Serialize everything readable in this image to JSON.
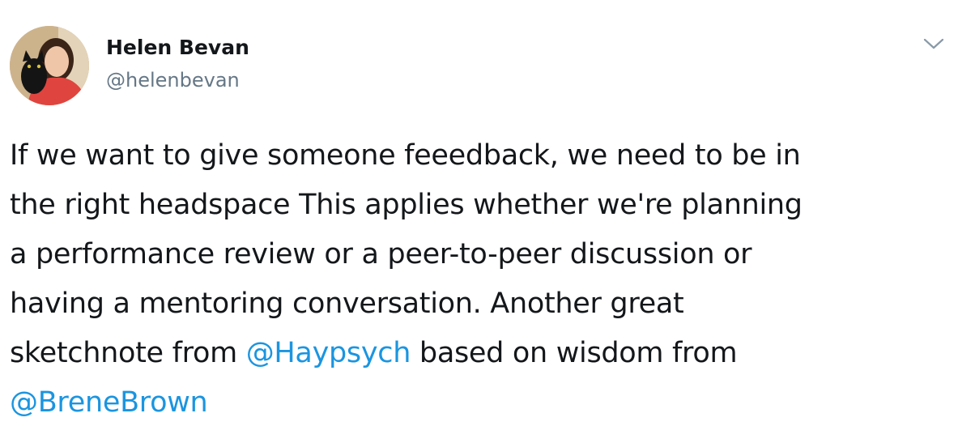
{
  "tweet": {
    "author": {
      "display_name": "Helen Bevan",
      "handle": "@helenbevan",
      "avatar_icon": "profile-photo-avatar"
    },
    "menu_icon": "chevron-down-icon",
    "text_lines": {
      "l1": "If we want to give someone feeedback, we need to be in",
      "l2": "the right headspace This applies whether we're planning",
      "l3": "a performance review or a peer-to-peer discussion or",
      "l4": "having a mentoring conversation. Another great",
      "l5_prefix": "sketchnote from ",
      "l5_mention": "@Haypsych",
      "l5_suffix": " based on wisdom from",
      "l6_mention": "@BreneBrown"
    },
    "colors": {
      "text": "#14171a",
      "secondary": "#657786",
      "link": "#1b95e0"
    }
  }
}
